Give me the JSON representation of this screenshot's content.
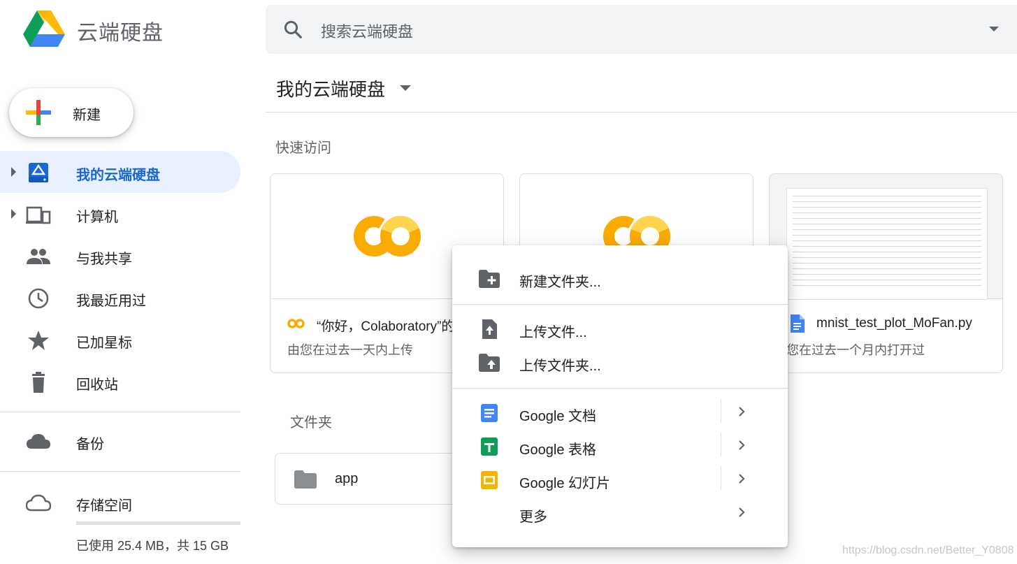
{
  "header": {
    "app_title": "云端硬盘",
    "search_placeholder": "搜索云端硬盘"
  },
  "new_button": {
    "label": "新建"
  },
  "sidebar": {
    "items": [
      {
        "label": "我的云端硬盘",
        "icon": "drive-icon",
        "active": true
      },
      {
        "label": "计算机",
        "icon": "computers-icon"
      },
      {
        "label": "与我共享",
        "icon": "people-icon"
      },
      {
        "label": "我最近用过",
        "icon": "clock-icon"
      },
      {
        "label": "已加星标",
        "icon": "star-icon"
      },
      {
        "label": "回收站",
        "icon": "trash-icon"
      },
      {
        "label": "备份",
        "icon": "cloud-icon"
      },
      {
        "label": "存储空间",
        "icon": "cloud-outline-icon"
      }
    ],
    "storage_text": "已使用 25.4 MB，共 15 GB"
  },
  "main": {
    "breadcrumb": "我的云端硬盘",
    "quick_access_label": "快速访问",
    "cards": [
      {
        "name": "“你好，Colaboratory”的",
        "subtitle": "由您在过去一天内上传"
      },
      {
        "name": "",
        "subtitle": ""
      },
      {
        "name": "mnist_test_plot_MoFan.py",
        "subtitle": "您在过去一个月内打开过"
      }
    ],
    "folders_label": "文件夹",
    "folders": [
      {
        "name": "app"
      }
    ]
  },
  "context_menu": {
    "items": [
      {
        "label": "新建文件夹...",
        "icon": "new-folder-icon"
      },
      {
        "label": "上传文件...",
        "icon": "upload-file-icon"
      },
      {
        "label": "上传文件夹...",
        "icon": "upload-folder-icon"
      },
      {
        "label": "Google 文档",
        "icon": "google-docs-icon",
        "submenu": true
      },
      {
        "label": "Google 表格",
        "icon": "google-sheets-icon",
        "submenu": true
      },
      {
        "label": "Google 幻灯片",
        "icon": "google-slides-icon",
        "submenu": true
      },
      {
        "label": "更多",
        "submenu": true
      }
    ]
  },
  "watermark": "https://blog.csdn.net/Better_Y0808",
  "colors": {
    "accent_blue": "#1967d2",
    "active_bg": "#e8f0fe",
    "colab_orange": "#f9ab00",
    "docs_blue": "#4285f4",
    "sheets_green": "#0f9d58",
    "slides_yellow": "#f4b400"
  }
}
